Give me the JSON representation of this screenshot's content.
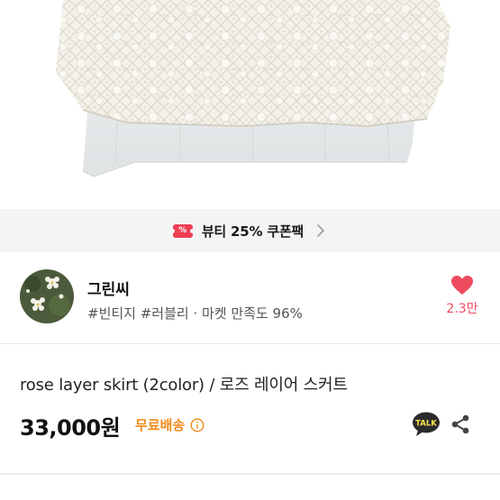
{
  "coupon": {
    "icon": "ticket-icon",
    "icon_glyph": "%",
    "text": "뷰티 25% 쿠폰팩",
    "accent": "#ee3e52"
  },
  "seller": {
    "name": "그린씨",
    "tags": "#빈티지 #러블리 · 마켓 만족도 96%",
    "likes": "2.3만",
    "like_color": "#ef4b5f"
  },
  "product": {
    "title": "rose layer skirt (2color) / 로즈 레이어 스커트",
    "price": "33,000원",
    "shipping": "무료배송",
    "shipping_color": "#f08a1a",
    "talk_label": "TALK"
  }
}
